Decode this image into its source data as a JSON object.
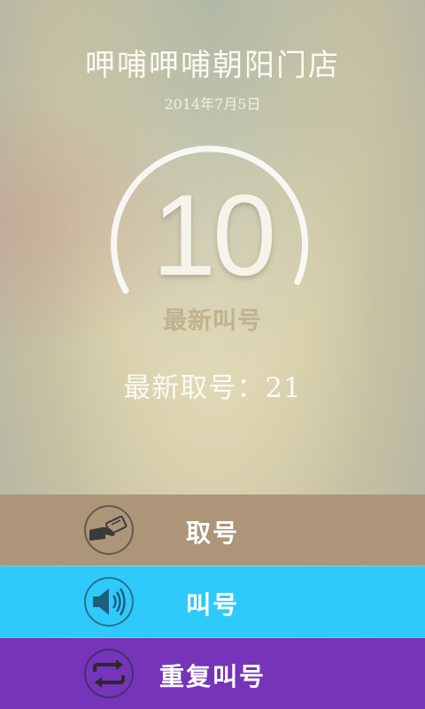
{
  "store": {
    "name": "呷哺呷哺朝阳门店",
    "date": "2014年7月5日"
  },
  "queue": {
    "current_called_number": "10",
    "current_called_label": "最新叫号",
    "latest_taken_text": "最新取号：21"
  },
  "actions": {
    "take_number": {
      "label": "取号",
      "icon": "take-ticket-icon",
      "color": "#ad957a"
    },
    "call_number": {
      "label": "叫号",
      "icon": "speaker-icon",
      "color": "#2fcafc"
    },
    "repeat_call": {
      "label": "重复叫号",
      "icon": "repeat-icon",
      "color": "#7534b9"
    }
  }
}
